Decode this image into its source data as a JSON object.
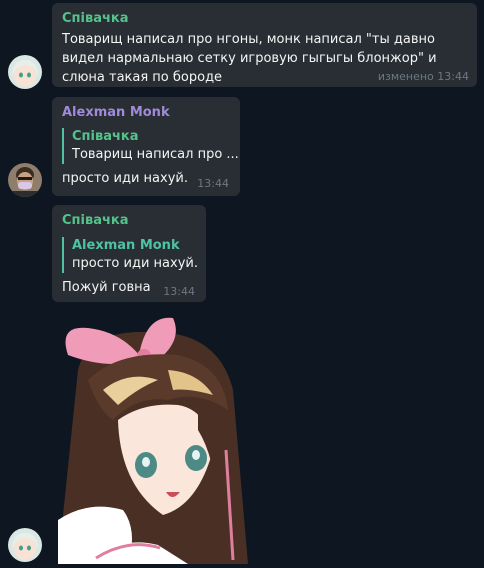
{
  "colors": {
    "background": "#0e1621",
    "bubble": "#282e33",
    "author_green": "#56c28b",
    "author_purple": "#a18ad7",
    "reply_bar": "#4fc3a1",
    "meta": "#6d7883"
  },
  "messages": [
    {
      "author": "Співачка",
      "text": "Товарищ написал про нгоны, монк написал \"ты давно видел нармальнаю сетку игровую гыгыгы блонжор\" и слюна такая по бороде",
      "edited": "изменено",
      "time": "13:44"
    },
    {
      "author": "Alexman Monk",
      "reply_author": "Співачка",
      "reply_text": "Товарищ написал про ...",
      "text": "просто иди нахуй.",
      "time": "13:44"
    },
    {
      "author": "Співачка",
      "reply_author": "Alexman Monk",
      "reply_text": "просто иди нахуй.",
      "text": "Пожуй говна",
      "time": "13:44"
    }
  ],
  "sticker": {
    "icon": "anime-girl-sticker"
  },
  "avatars": [
    "anime-avatar-icon",
    "person-masked-avatar-icon",
    "anime-avatar-icon"
  ]
}
